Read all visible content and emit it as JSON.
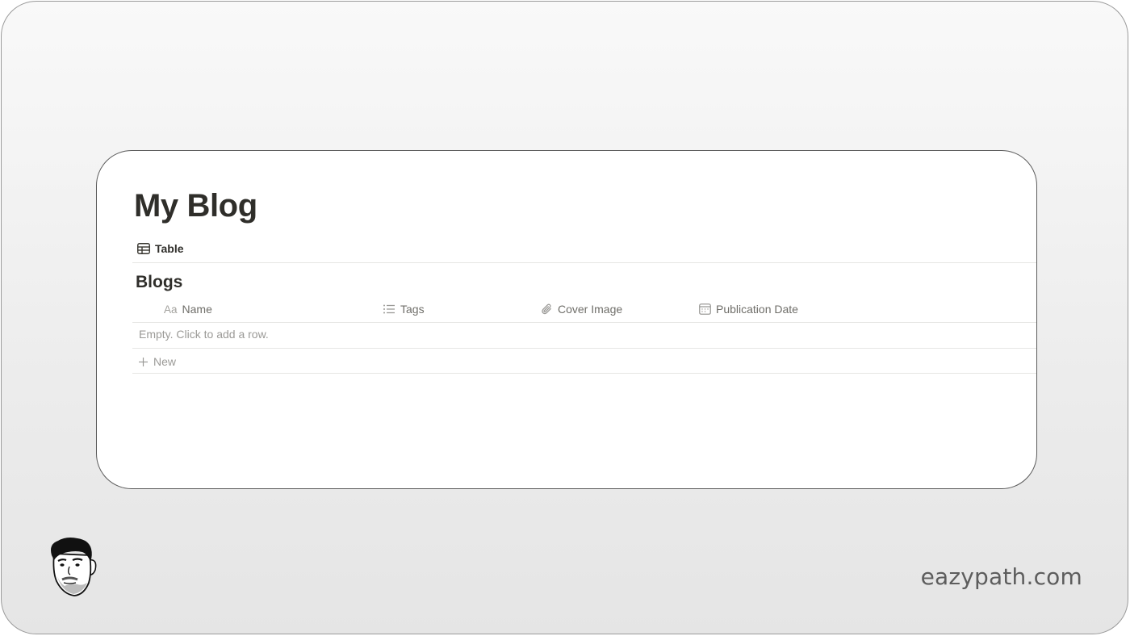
{
  "page": {
    "title": "My Blog"
  },
  "view_tab": {
    "label": "Table",
    "icon": "table-icon"
  },
  "database": {
    "title": "Blogs",
    "columns": [
      {
        "label": "Name",
        "type_badge": "Aa",
        "icon": "text-type-icon"
      },
      {
        "label": "Tags",
        "icon": "list-icon"
      },
      {
        "label": "Cover Image",
        "icon": "paperclip-icon"
      },
      {
        "label": "Publication Date",
        "icon": "calendar-icon"
      }
    ],
    "empty_text": "Empty. Click to add a row.",
    "new_label": "New",
    "new_icon": "plus-icon"
  },
  "branding": {
    "site": "eazypath.com",
    "avatar_icon": "face-avatar-illustration"
  },
  "colors": {
    "title_text": "#2f2e2a",
    "muted_text": "#9b9a97",
    "header_text": "#6f6e69",
    "card_border": "#5b5b5b",
    "divider": "#e6e6e4"
  }
}
